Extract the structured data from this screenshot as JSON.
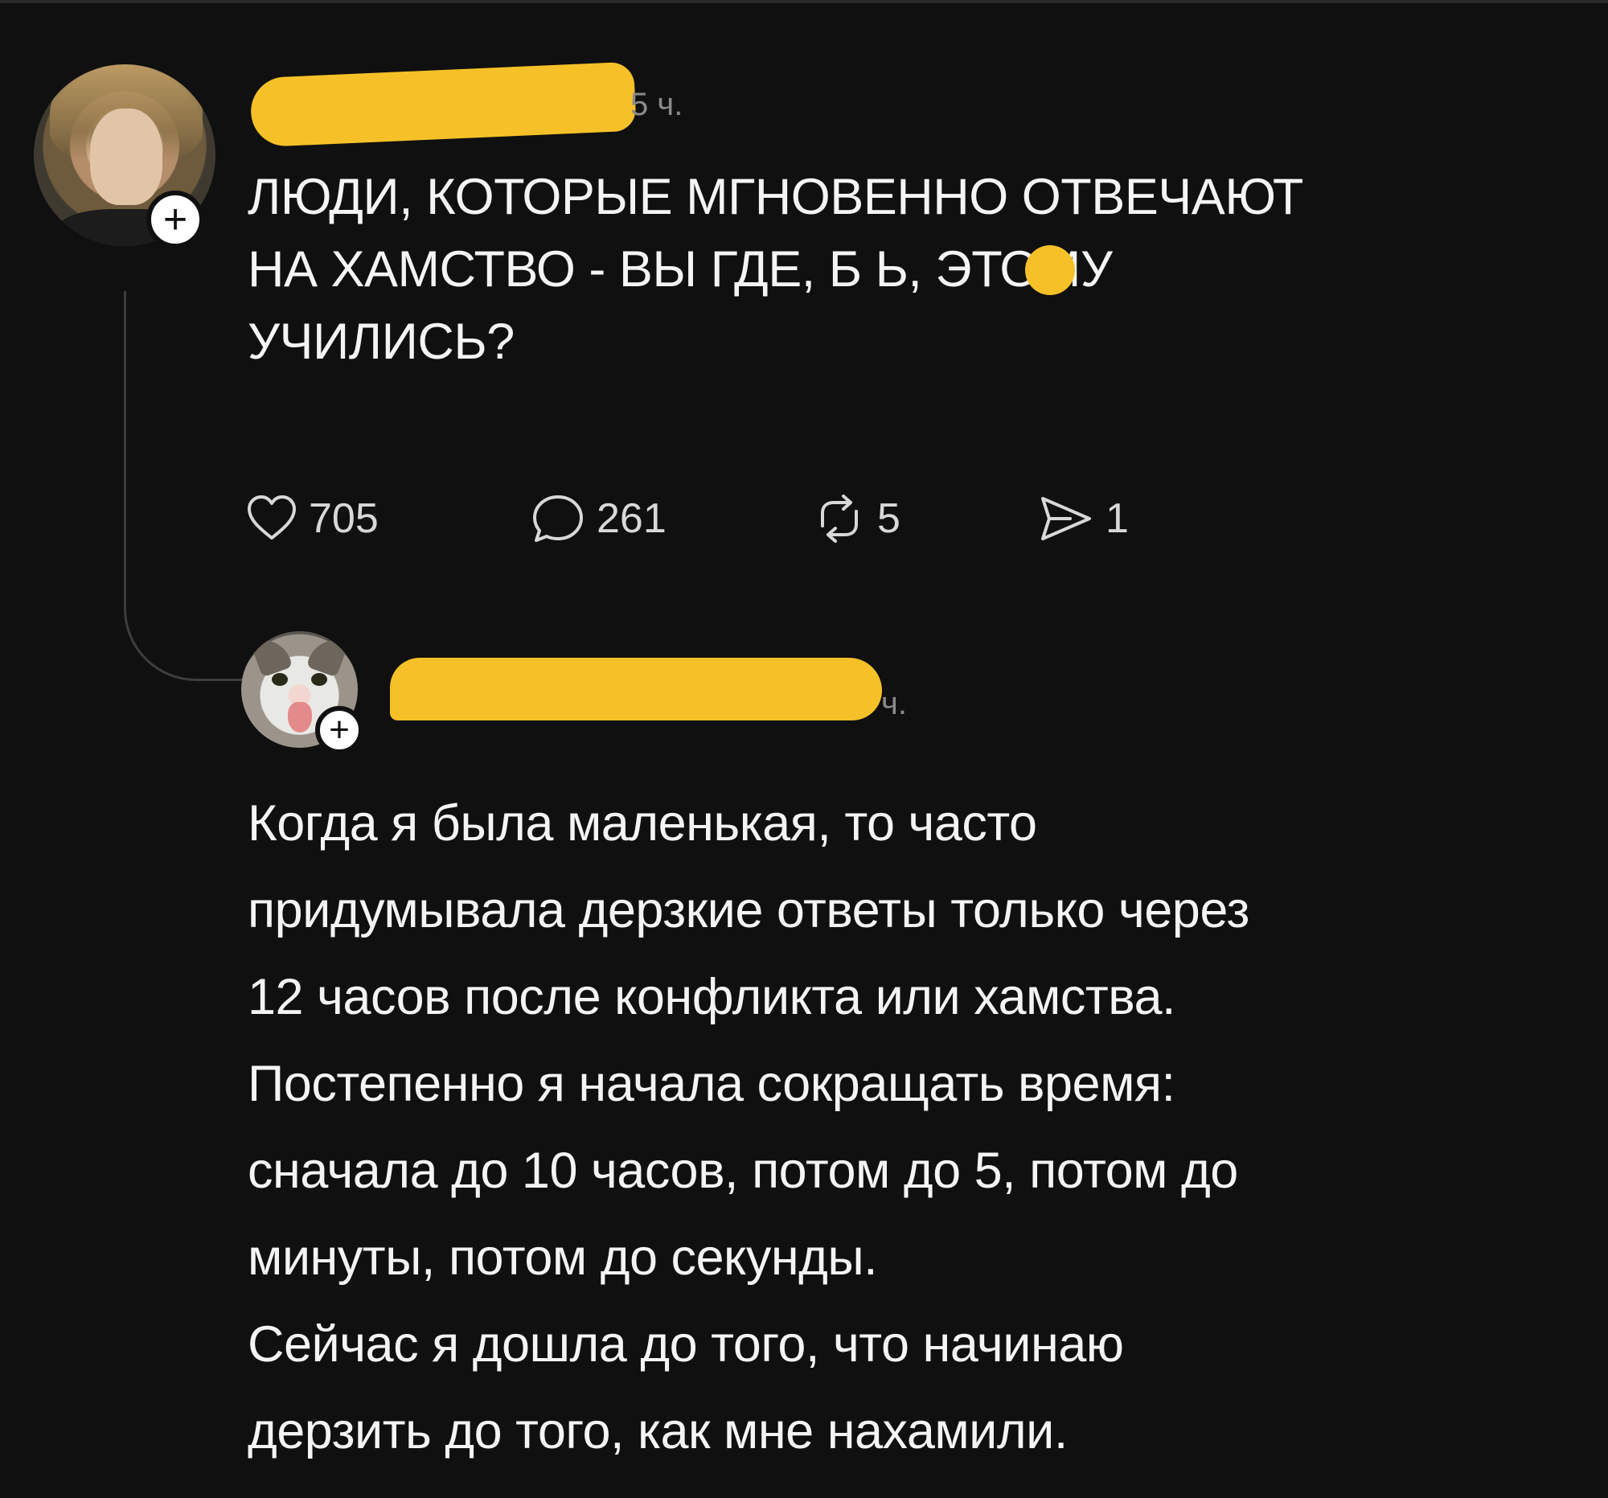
{
  "post": {
    "author_name": "",
    "time": "5 ч.",
    "lines": [
      "ЛЮДИ, КОТОРЫЕ МГНОВЕННО ОТВЕЧАЮТ",
      "НА ХАМСТВО - ВЫ ГДЕ, Б     Ь, ЭТОМУ",
      "УЧИЛИСЬ?"
    ],
    "actions": {
      "likes": "705",
      "comments": "261",
      "reposts": "5",
      "shares": "1"
    },
    "follow_badge": "+"
  },
  "reply": {
    "author_name": "",
    "time": "ч.",
    "follow_badge": "+",
    "lines": [
      "Когда я была маленькая, то часто",
      "придумывала дерзкие ответы только через",
      "12 часов после конфликта или хамства.",
      "Постепенно я начала сокращать время:",
      "сначала до 10 часов, потом до 5, потом до",
      "минуты, потом до секунды.",
      "Сейчас я дошла до того, что начинаю",
      "дерзить до того, как мне нахамили."
    ]
  },
  "icons": {
    "like": "heart-icon",
    "comment": "speech-bubble-icon",
    "repost": "repost-arrows-icon",
    "share": "send-arrow-icon",
    "follow": "plus-icon"
  },
  "colors": {
    "background": "#101010",
    "text": "#f4f4f4",
    "muted": "#8a8a8a",
    "redaction": "#f6c128",
    "thread_line": "#3d3d3d"
  }
}
